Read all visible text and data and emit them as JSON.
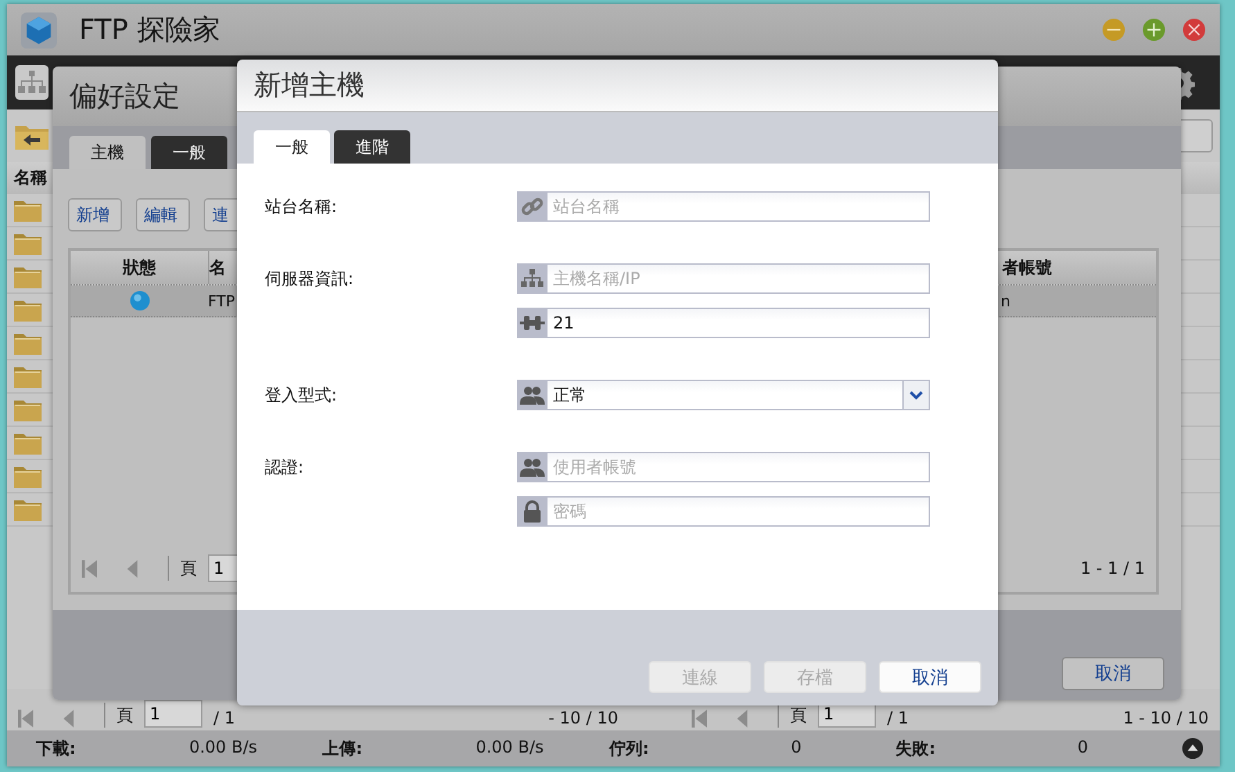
{
  "app": {
    "title": "FTP 探險家"
  },
  "file_pane": {
    "header": "名稱",
    "rows": [
      {
        "kind": "folder"
      },
      {
        "kind": "folder"
      },
      {
        "kind": "folder"
      },
      {
        "kind": "folder"
      },
      {
        "kind": "folder"
      },
      {
        "kind": "folder"
      },
      {
        "kind": "folder"
      },
      {
        "kind": "folder"
      },
      {
        "kind": "folder"
      },
      {
        "kind": "folder"
      }
    ]
  },
  "bottom_pagers": [
    {
      "page_label": "頁",
      "page": "1",
      "total": "/ 1",
      "range": "- 10 / 10"
    },
    {
      "page_label": "頁",
      "page": "1",
      "total": "/ 1",
      "range": "1 - 10 / 10"
    }
  ],
  "status_bar": [
    {
      "label": "下載:",
      "value": "0.00 B/s"
    },
    {
      "label": "上傳:",
      "value": "0.00 B/s"
    },
    {
      "label": "佇列:",
      "value": "0"
    },
    {
      "label": "失敗:",
      "value": "0"
    }
  ],
  "preferences": {
    "title": "偏好設定",
    "tabs": [
      {
        "label": "主機",
        "selected": true
      },
      {
        "label": "一般",
        "selected": false
      }
    ],
    "buttons": [
      "新增",
      "編輯",
      "連"
    ],
    "table": {
      "columns": [
        "狀態",
        "名",
        "者帳號"
      ],
      "rows": [
        {
          "kind": "online",
          "selected": true,
          "cells": [
            "",
            "FTP",
            "n"
          ]
        }
      ]
    },
    "pager": {
      "page_label": "頁",
      "page": "1",
      "range": "1 - 1 / 1"
    },
    "cancel": "取消"
  },
  "dialog": {
    "title": "新增主機",
    "tabs": [
      {
        "label": "一般",
        "selected": true
      },
      {
        "label": "進階",
        "selected": false
      }
    ],
    "groups": [
      {
        "label": "站台名稱:",
        "fields": [
          {
            "kind": "site",
            "placeholder": "站台名稱"
          }
        ]
      },
      {
        "label": "伺服器資訊:",
        "fields": [
          {
            "kind": "host",
            "placeholder": "主機名稱/IP"
          },
          {
            "kind": "port",
            "value": "21"
          }
        ]
      },
      {
        "label": "登入型式:",
        "fields": [
          {
            "kind": "login",
            "value": "正常"
          }
        ]
      },
      {
        "label": "認證:",
        "fields": [
          {
            "kind": "user",
            "placeholder": "使用者帳號"
          },
          {
            "kind": "password",
            "placeholder": "密碼"
          }
        ]
      }
    ],
    "buttons": [
      {
        "label": "連線",
        "disabled": true
      },
      {
        "label": "存檔",
        "disabled": true
      },
      {
        "label": "取消",
        "disabled": false
      }
    ]
  }
}
